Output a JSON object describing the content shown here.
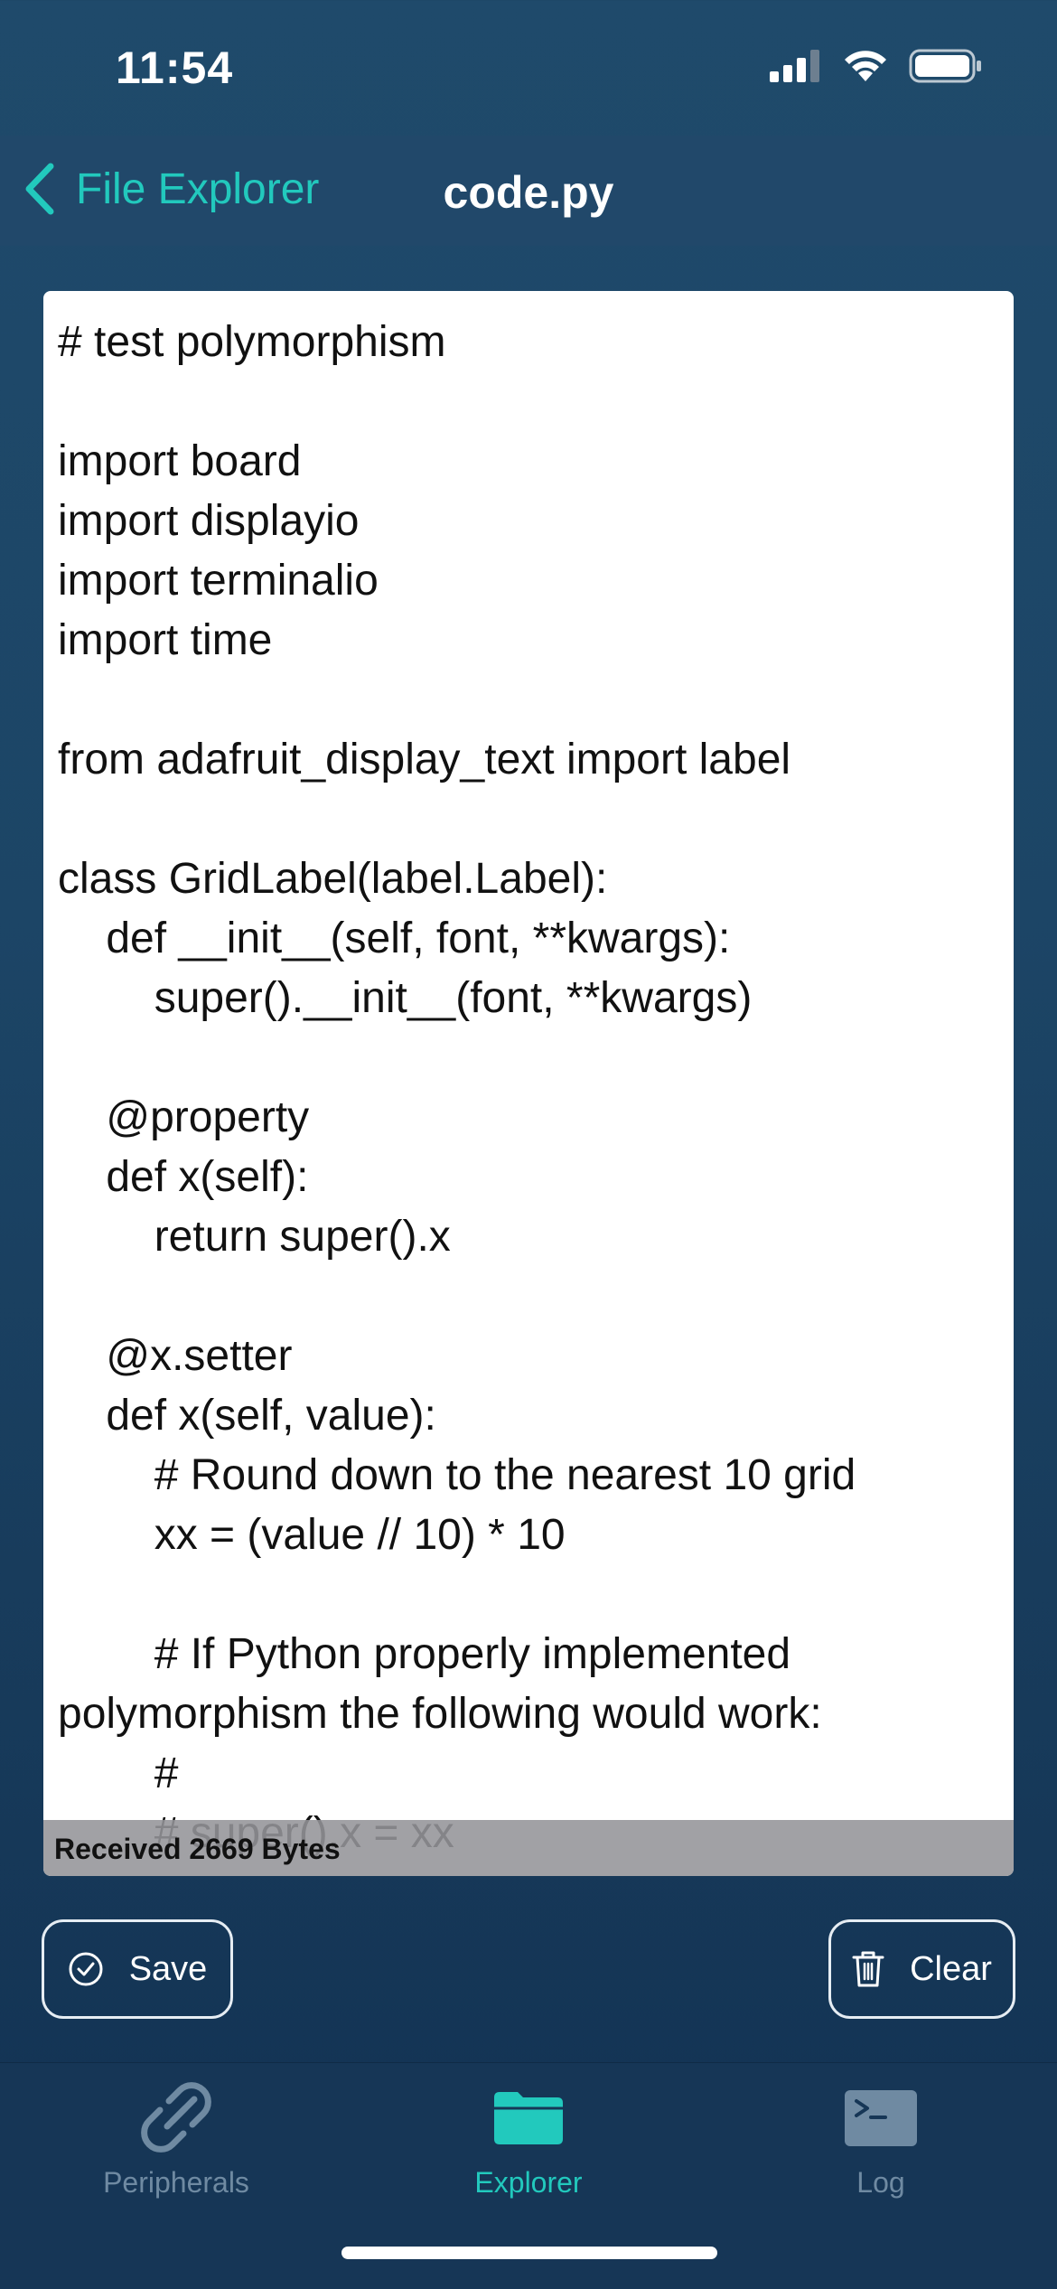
{
  "status": {
    "time": "11:54"
  },
  "nav": {
    "back_label": "File Explorer",
    "title": "code.py"
  },
  "code": {
    "content": "# test polymorphism\n\nimport board\nimport displayio\nimport terminalio\nimport time\n\nfrom adafruit_display_text import label\n\nclass GridLabel(label.Label):\n    def __init__(self, font, **kwargs):\n        super().__init__(font, **kwargs)\n\n    @property\n    def x(self):\n        return super().x\n\n    @x.setter\n    def x(self, value):\n        # Round down to the nearest 10 grid\n        xx = (value // 10) * 10\n\n        # If Python properly implemented polymorphism the following would work:\n        #\n        # super().x = xx\n        #"
  },
  "received": {
    "text": "Received 2669 Bytes"
  },
  "actions": {
    "save_label": "Save",
    "clear_label": "Clear"
  },
  "tabs": [
    {
      "label": "Peripherals",
      "icon": "link-icon",
      "active": false
    },
    {
      "label": "Explorer",
      "icon": "folder-icon",
      "active": true
    },
    {
      "label": "Log",
      "icon": "terminal-icon",
      "active": false
    }
  ],
  "colors": {
    "accent": "#22c9bd",
    "inactive": "#6f8aa2",
    "background": "#1f4a6b"
  }
}
